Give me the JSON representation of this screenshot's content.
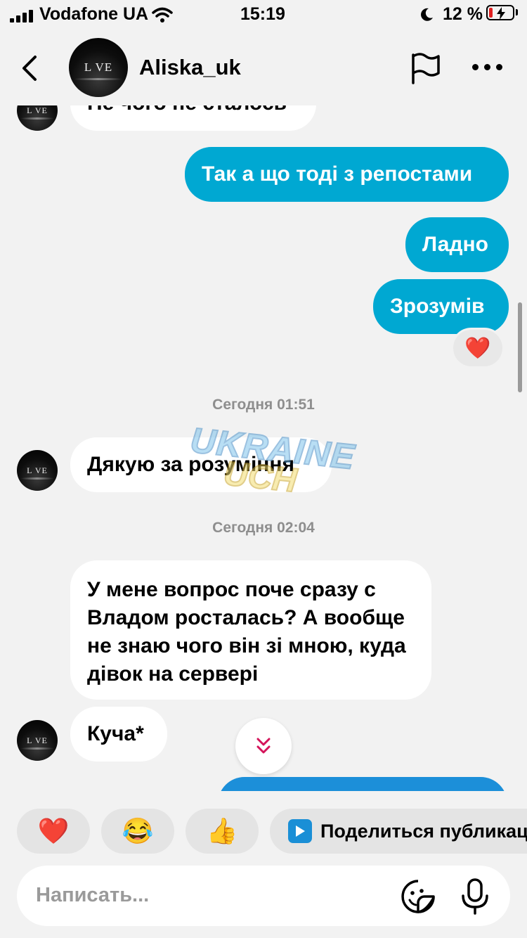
{
  "status": {
    "carrier": "Vodafone UA",
    "time": "15:19",
    "battery": "12 %"
  },
  "header": {
    "username": "Aliska_uk",
    "avatar_text": "L VE"
  },
  "messages": {
    "partial_in": "Не чого не сталось",
    "out_1": "Так а що тоді з репостами",
    "out_2": "Ладно",
    "out_3": "Зрозумів",
    "reaction": "❤️",
    "time_1": "Сегодня 01:51",
    "in_1": "Дякую за розуміння",
    "time_2": "Сегодня 02:04",
    "in_2": "У мене вопрос поче сразу с Владом росталась? А вообще не знаю чого він зі мною, куда дівок на сервері",
    "in_3": "Куча*"
  },
  "watermark": {
    "line1": "UKRAINE",
    "line2": "UCH"
  },
  "quick_reactions": {
    "heart": "❤️",
    "laugh": "😂",
    "thumbs": "👍",
    "share_label": "Поделиться публикацией"
  },
  "composer": {
    "placeholder": "Написать..."
  },
  "colors": {
    "outgoing": "#00a8d2",
    "incoming": "#ffffff",
    "background": "#f2f2f2",
    "scroll_arrow": "#d4145a"
  }
}
